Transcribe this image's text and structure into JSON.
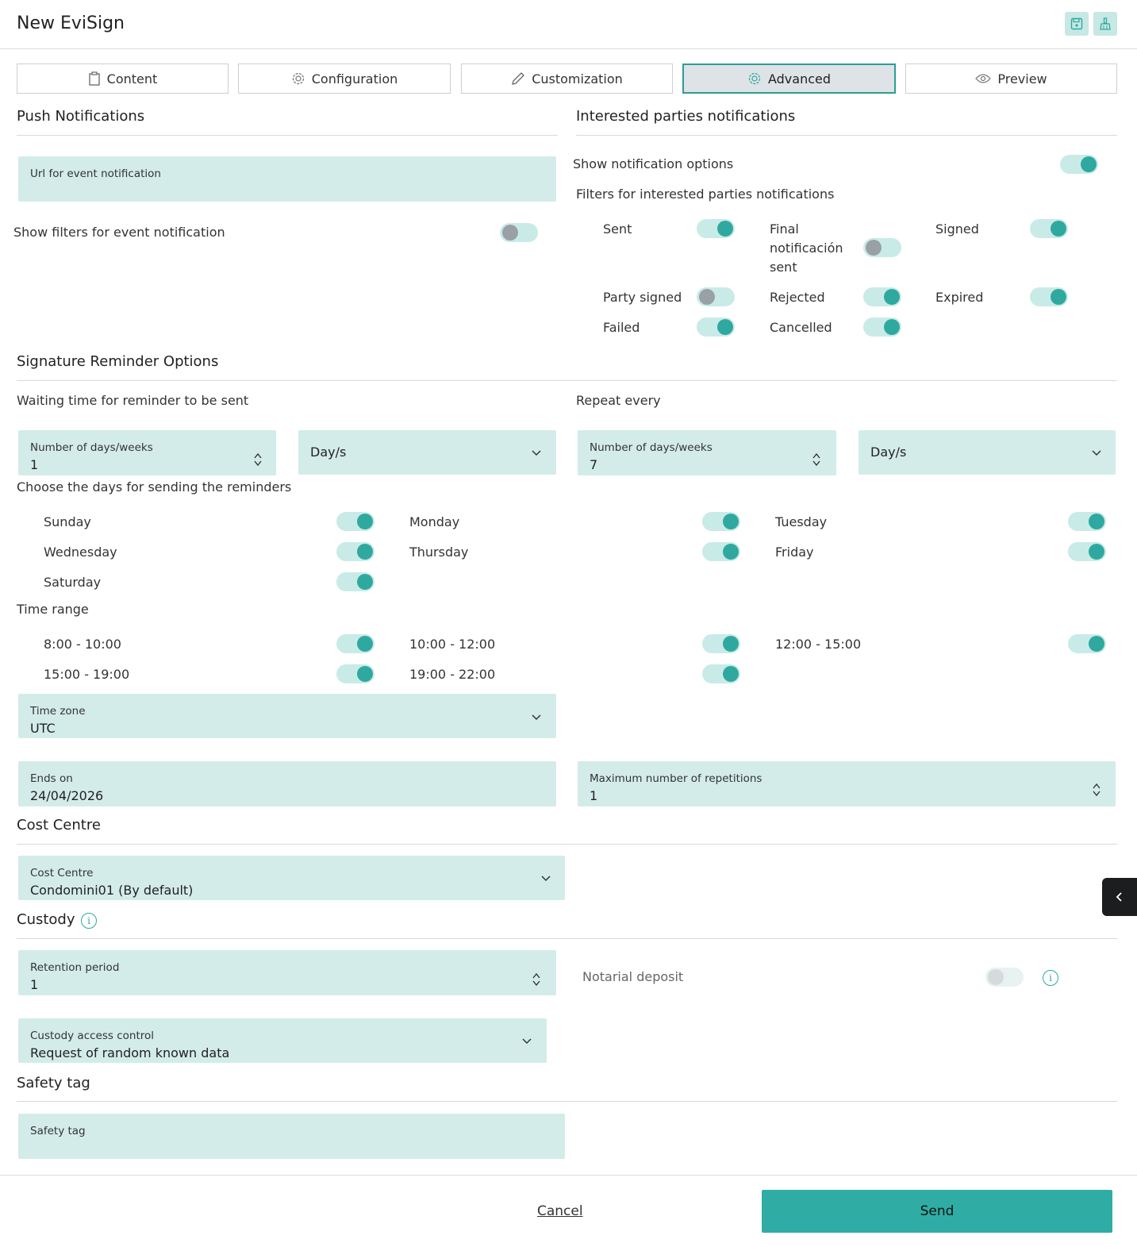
{
  "header": {
    "title": "New EviSign",
    "save_icon": "save-icon",
    "clean_icon": "broom-icon"
  },
  "tabs": [
    {
      "label": "Content",
      "icon": "clipboard-icon"
    },
    {
      "label": "Configuration",
      "icon": "gear-icon"
    },
    {
      "label": "Customization",
      "icon": "pencil-icon"
    },
    {
      "label": "Advanced",
      "icon": "cog-icon",
      "active": true
    },
    {
      "label": "Preview",
      "icon": "eye-icon"
    }
  ],
  "push": {
    "title": "Push Notifications",
    "url_label": "Url for event notification",
    "url_value": "",
    "show_filters_label": "Show filters for event notification",
    "show_filters_on": false
  },
  "interested": {
    "title": "Interested parties notifications",
    "show_options_label": "Show notification options",
    "show_options_on": true,
    "filters_label": "Filters for interested parties notifications",
    "filters": {
      "sent": {
        "label": "Sent",
        "on": true
      },
      "final_line1": "Final",
      "final_line2": "notificación",
      "final_line3": "sent",
      "final_on": false,
      "signed": {
        "label": "Signed",
        "on": true
      },
      "party_signed": {
        "label": "Party signed",
        "on": false
      },
      "rejected": {
        "label": "Rejected",
        "on": true
      },
      "expired": {
        "label": "Expired",
        "on": true
      },
      "failed": {
        "label": "Failed",
        "on": true
      },
      "cancelled": {
        "label": "Cancelled",
        "on": true
      }
    }
  },
  "reminder": {
    "title": "Signature Reminder Options",
    "waiting_label": "Waiting time for reminder to be sent",
    "repeat_label": "Repeat every",
    "wait_number_label": "Number of days/weeks",
    "wait_number_value": "1",
    "wait_unit": "Day/s",
    "repeat_number_label": "Number of days/weeks",
    "repeat_number_value": "7",
    "repeat_unit": "Day/s",
    "days_label": "Choose the days for sending the reminders",
    "days": {
      "sunday": "Sunday",
      "monday": "Monday",
      "tuesday": "Tuesday",
      "wednesday": "Wednesday",
      "thursday": "Thursday",
      "friday": "Friday",
      "saturday": "Saturday"
    },
    "time_range_label": "Time range",
    "ranges": {
      "r1": "8:00 - 10:00",
      "r2": "10:00 - 12:00",
      "r3": "12:00 - 15:00",
      "r4": "15:00 - 19:00",
      "r5": "19:00 - 22:00"
    },
    "timezone_label": "Time zone",
    "timezone_value": "UTC",
    "ends_label": "Ends on",
    "ends_value": "24/04/2026",
    "max_rep_label": "Maximum number of repetitions",
    "max_rep_value": "1"
  },
  "cost": {
    "title": "Cost Centre",
    "field_label": "Cost Centre",
    "field_value": "Condomini01 (By default)"
  },
  "custody": {
    "title": "Custody",
    "info_glyph": "i",
    "retention_label": "Retention period",
    "retention_value": "1",
    "notarial_label": "Notarial deposit",
    "notarial_on": false,
    "access_label": "Custody access control",
    "access_value": "Request of random known data"
  },
  "safety": {
    "title": "Safety tag",
    "field_label": "Safety tag",
    "field_value": ""
  },
  "footer": {
    "cancel": "Cancel",
    "send": "Send"
  },
  "colors": {
    "accent": "#2fa9a0",
    "field_bg": "#d3ecea",
    "toggle_track": "#c9ebe8",
    "send_bg": "#2fada4"
  }
}
